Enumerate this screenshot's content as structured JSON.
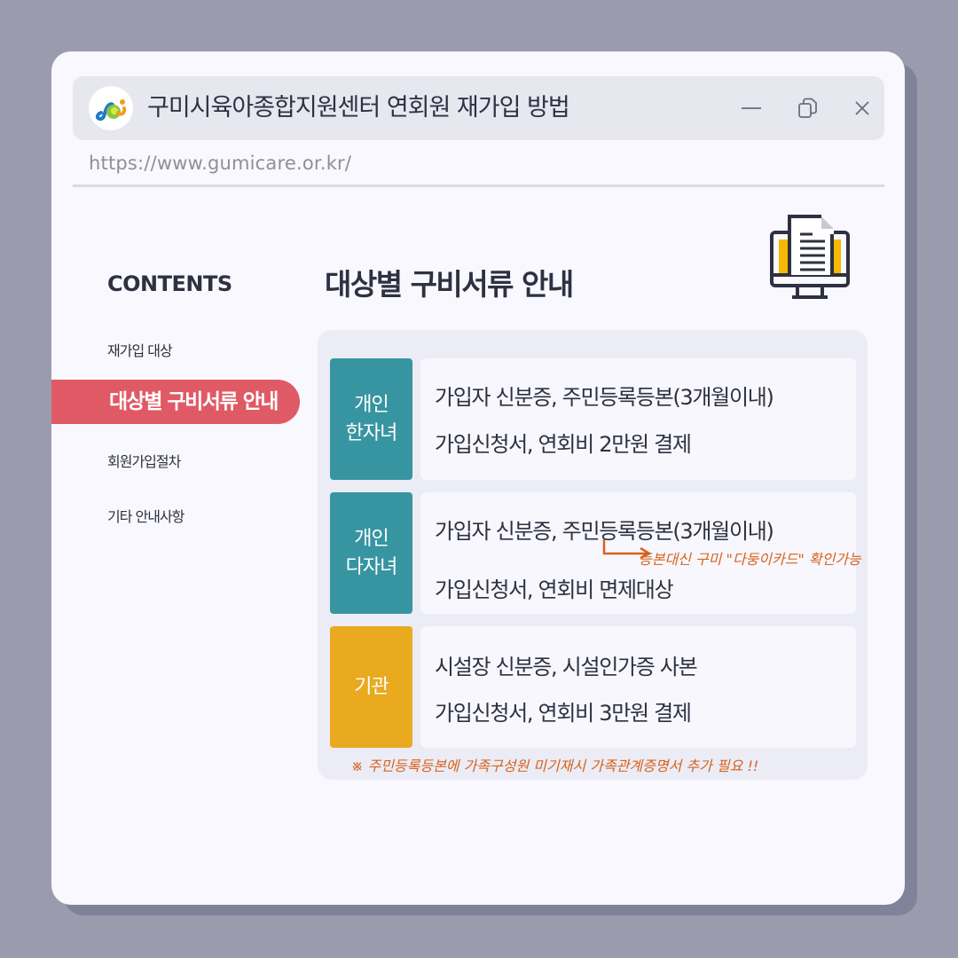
{
  "window": {
    "title": "구미시육아종합지원센터 연회원 재가입 방법",
    "url": "https://www.gumicare.or.kr/",
    "controls": {
      "minimize": "minimize-icon",
      "restore": "restore-icon",
      "close": "close-icon"
    }
  },
  "sidebar": {
    "heading": "CONTENTS",
    "items": [
      {
        "label": "재가입 대상",
        "active": false
      },
      {
        "label": "대상별 구비서류 안내",
        "active": true
      },
      {
        "label": "회원가입절차",
        "active": false
      },
      {
        "label": "기타 안내사항",
        "active": false
      }
    ]
  },
  "main": {
    "title": "대상별 구비서류 안내",
    "icon": "document-monitor-icon",
    "rows": [
      {
        "tag": [
          "개인",
          "한자녀"
        ],
        "color": "#3795a1",
        "lines": [
          "가입자 신분증, 주민등록등본(3개월이내)",
          "가입신청서, 연회비 2만원 결제"
        ]
      },
      {
        "tag": [
          "개인",
          "다자녀"
        ],
        "color": "#3795a1",
        "lines": [
          "가입자 신분증, 주민등록등본(3개월이내)",
          "가입신청서, 연회비 면제대상"
        ],
        "annotation": "등본대신 구미 \"다둥이카드\" 확인가능"
      },
      {
        "tag": [
          "기관"
        ],
        "color": "#e9aa1f",
        "lines": [
          "시설장 신분증, 시설인가증 사본",
          "가입신청서, 연회비 3만원 결제"
        ]
      }
    ],
    "footnote": "※ 주민등록등본에 가족구성원 미기재시 가족관계증명서 추가 필요 !!"
  },
  "colors": {
    "accent_active": "#e05a66",
    "teal": "#3795a1",
    "gold": "#e9aa1f",
    "annotation": "#d9621c"
  }
}
